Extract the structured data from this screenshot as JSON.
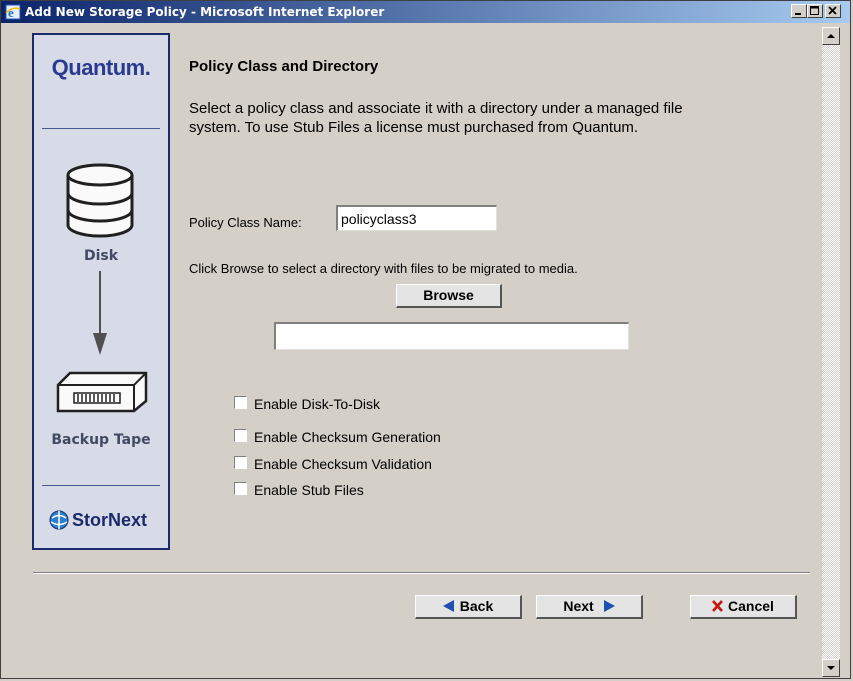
{
  "window": {
    "title": "Add New Storage Policy - Microsoft Internet Explorer"
  },
  "sidebar": {
    "logo": "Quantum.",
    "disk_label": "Disk",
    "tape_label": "Backup Tape",
    "brand": "StorNext"
  },
  "main": {
    "heading": "Policy Class and Directory",
    "description": "Select a policy class and associate it with a directory under a managed file system. To use Stub Files a license must purchased from Quantum.",
    "policy_class_label": "Policy Class Name:",
    "policy_class_value": "policyclass3",
    "browse_instruction": "Click Browse to select a directory with files to be migrated to media.",
    "browse_button": "Browse",
    "directory_value": "",
    "options": [
      {
        "label": "Enable Disk-To-Disk",
        "checked": false
      },
      {
        "label": "Enable Checksum Generation",
        "checked": false
      },
      {
        "label": "Enable Checksum Validation",
        "checked": false
      },
      {
        "label": "Enable Stub Files",
        "checked": false
      }
    ]
  },
  "footer": {
    "back_label": "Back",
    "next_label": "Next",
    "cancel_label": "Cancel"
  },
  "colors": {
    "titlebar_start": "#0a246a",
    "titlebar_end": "#a6caf0",
    "panel_border": "#1c2a6b",
    "brand_blue": "#2a3a8f",
    "arrow_blue": "#1f4fb3",
    "cancel_red": "#cc1111"
  }
}
